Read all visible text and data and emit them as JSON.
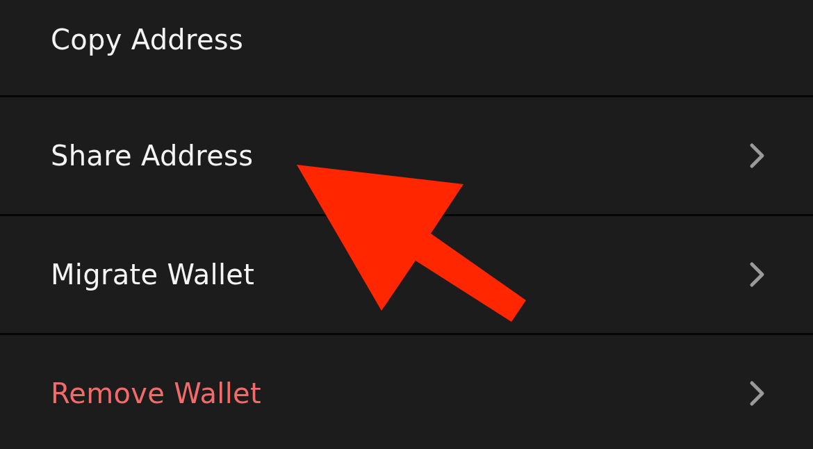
{
  "menu": [
    {
      "label": "Copy Address",
      "kind": "normal",
      "has_chevron": false
    },
    {
      "label": "Share Address",
      "kind": "normal",
      "has_chevron": true
    },
    {
      "label": "Migrate Wallet",
      "kind": "normal",
      "has_chevron": true
    },
    {
      "label": "Remove Wallet",
      "kind": "destructive",
      "has_chevron": true
    }
  ]
}
